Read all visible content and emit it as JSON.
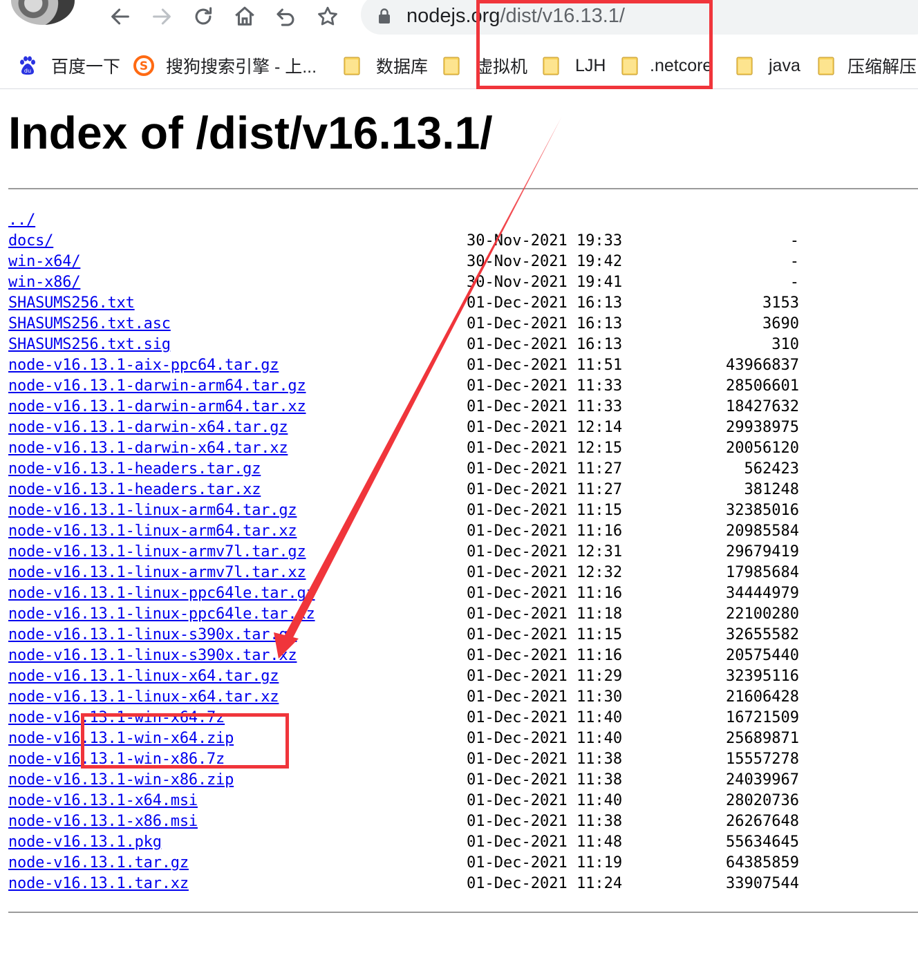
{
  "browser": {
    "url_host": "nodejs.org",
    "url_path": "/dist/v16.13.1/",
    "bookmarks": [
      {
        "label": "百度一下",
        "icon": "baidu-paw-icon"
      },
      {
        "label": "搜狗搜索引擎 - 上...",
        "icon": "sogou-s-icon"
      },
      {
        "label": "数据库",
        "icon": "folder-icon"
      },
      {
        "label": "虚拟机",
        "icon": "folder-icon"
      },
      {
        "label": "LJH",
        "icon": "folder-icon"
      },
      {
        "label": ".netcore",
        "icon": "folder-icon"
      },
      {
        "label": "java",
        "icon": "folder-icon"
      },
      {
        "label": "压缩解压",
        "icon": "folder-icon"
      }
    ],
    "colors": {
      "annotation": "#f0353b",
      "link": "#0000ee",
      "sogou": "#ff6a13",
      "baidu": "#2932e1",
      "folder": "#f9d35b"
    }
  },
  "page": {
    "title": "Index of /dist/v16.13.1/",
    "entries": [
      {
        "name": "../",
        "date": "",
        "size": ""
      },
      {
        "name": "docs/",
        "date": "30-Nov-2021 19:33",
        "size": "-"
      },
      {
        "name": "win-x64/",
        "date": "30-Nov-2021 19:42",
        "size": "-"
      },
      {
        "name": "win-x86/",
        "date": "30-Nov-2021 19:41",
        "size": "-"
      },
      {
        "name": "SHASUMS256.txt",
        "date": "01-Dec-2021 16:13",
        "size": "3153"
      },
      {
        "name": "SHASUMS256.txt.asc",
        "date": "01-Dec-2021 16:13",
        "size": "3690"
      },
      {
        "name": "SHASUMS256.txt.sig",
        "date": "01-Dec-2021 16:13",
        "size": "310"
      },
      {
        "name": "node-v16.13.1-aix-ppc64.tar.gz",
        "date": "01-Dec-2021 11:51",
        "size": "43966837"
      },
      {
        "name": "node-v16.13.1-darwin-arm64.tar.gz",
        "date": "01-Dec-2021 11:33",
        "size": "28506601"
      },
      {
        "name": "node-v16.13.1-darwin-arm64.tar.xz",
        "date": "01-Dec-2021 11:33",
        "size": "18427632"
      },
      {
        "name": "node-v16.13.1-darwin-x64.tar.gz",
        "date": "01-Dec-2021 12:14",
        "size": "29938975"
      },
      {
        "name": "node-v16.13.1-darwin-x64.tar.xz",
        "date": "01-Dec-2021 12:15",
        "size": "20056120"
      },
      {
        "name": "node-v16.13.1-headers.tar.gz",
        "date": "01-Dec-2021 11:27",
        "size": "562423"
      },
      {
        "name": "node-v16.13.1-headers.tar.xz",
        "date": "01-Dec-2021 11:27",
        "size": "381248"
      },
      {
        "name": "node-v16.13.1-linux-arm64.tar.gz",
        "date": "01-Dec-2021 11:15",
        "size": "32385016"
      },
      {
        "name": "node-v16.13.1-linux-arm64.tar.xz",
        "date": "01-Dec-2021 11:16",
        "size": "20985584"
      },
      {
        "name": "node-v16.13.1-linux-armv7l.tar.gz",
        "date": "01-Dec-2021 12:31",
        "size": "29679419"
      },
      {
        "name": "node-v16.13.1-linux-armv7l.tar.xz",
        "date": "01-Dec-2021 12:32",
        "size": "17985684"
      },
      {
        "name": "node-v16.13.1-linux-ppc64le.tar.gz",
        "date": "01-Dec-2021 11:16",
        "size": "34444979"
      },
      {
        "name": "node-v16.13.1-linux-ppc64le.tar.xz",
        "date": "01-Dec-2021 11:18",
        "size": "22100280"
      },
      {
        "name": "node-v16.13.1-linux-s390x.tar.gz",
        "date": "01-Dec-2021 11:15",
        "size": "32655582"
      },
      {
        "name": "node-v16.13.1-linux-s390x.tar.xz",
        "date": "01-Dec-2021 11:16",
        "size": "20575440"
      },
      {
        "name": "node-v16.13.1-linux-x64.tar.gz",
        "date": "01-Dec-2021 11:29",
        "size": "32395116"
      },
      {
        "name": "node-v16.13.1-linux-x64.tar.xz",
        "date": "01-Dec-2021 11:30",
        "size": "21606428"
      },
      {
        "name": "node-v16.13.1-win-x64.7z",
        "date": "01-Dec-2021 11:40",
        "size": "16721509"
      },
      {
        "name": "node-v16.13.1-win-x64.zip",
        "date": "01-Dec-2021 11:40",
        "size": "25689871"
      },
      {
        "name": "node-v16.13.1-win-x86.7z",
        "date": "01-Dec-2021 11:38",
        "size": "15557278"
      },
      {
        "name": "node-v16.13.1-win-x86.zip",
        "date": "01-Dec-2021 11:38",
        "size": "24039967"
      },
      {
        "name": "node-v16.13.1-x64.msi",
        "date": "01-Dec-2021 11:40",
        "size": "28020736"
      },
      {
        "name": "node-v16.13.1-x86.msi",
        "date": "01-Dec-2021 11:38",
        "size": "26267648"
      },
      {
        "name": "node-v16.13.1.pkg",
        "date": "01-Dec-2021 11:48",
        "size": "55634645"
      },
      {
        "name": "node-v16.13.1.tar.gz",
        "date": "01-Dec-2021 11:19",
        "size": "64385859"
      },
      {
        "name": "node-v16.13.1.tar.xz",
        "date": "01-Dec-2021 11:24",
        "size": "33907544"
      }
    ]
  }
}
